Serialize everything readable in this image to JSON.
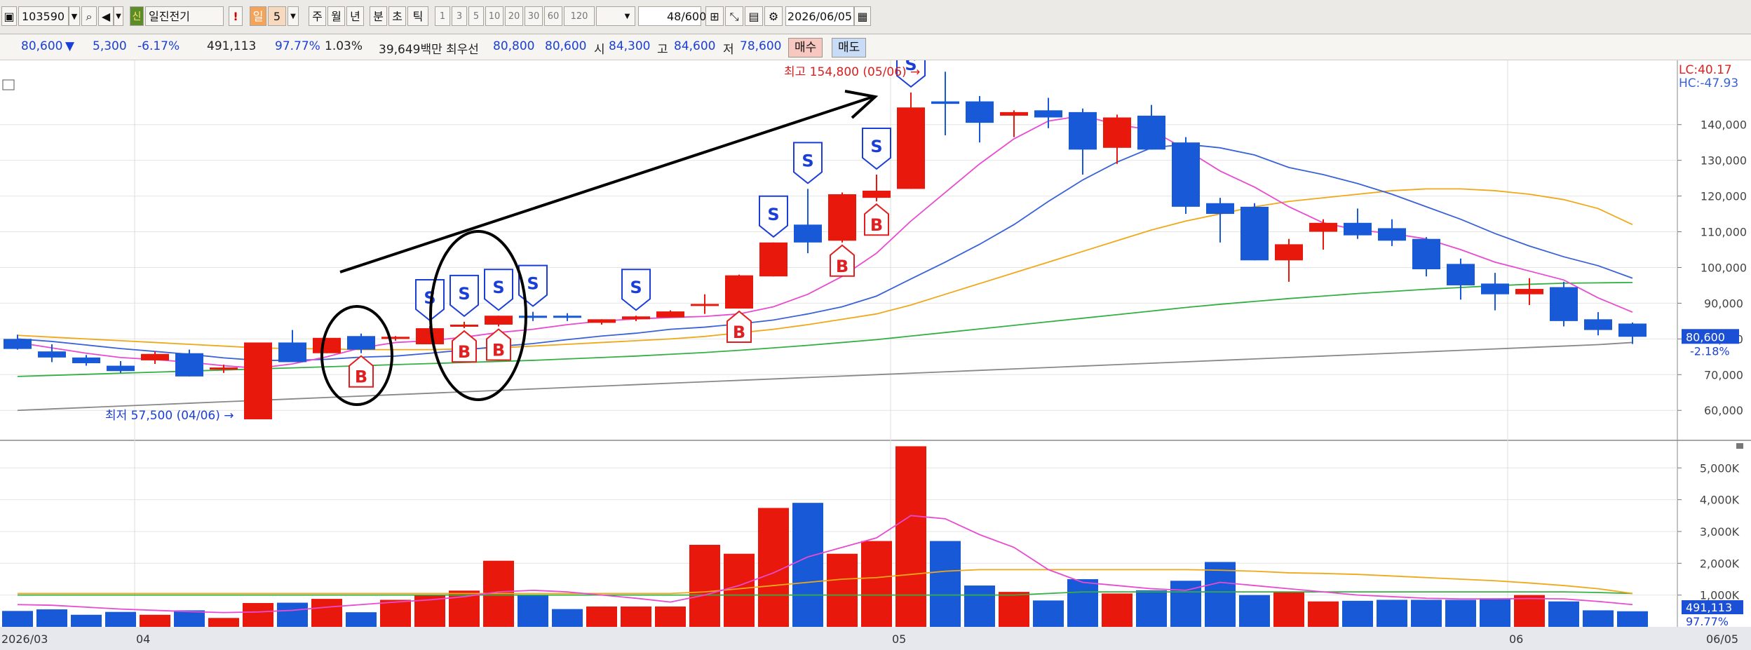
{
  "toolbar": {
    "code": "103590",
    "stock_name": "일진전기",
    "badge": "신",
    "period_active": "일",
    "period_num": "5",
    "period_tabs": [
      "주",
      "월",
      "년",
      "분",
      "초",
      "틱"
    ],
    "minute_options": [
      "1",
      "3",
      "5",
      "10",
      "20",
      "30",
      "60",
      "120"
    ],
    "count_value": "48",
    "count_total": "/600",
    "date": "2026/06/05",
    "icons": [
      "chart-menu-icon",
      "search-icon",
      "sound-icon",
      "alert-icon",
      "add-indicator-icon",
      "line-tool-icon",
      "save-icon",
      "settings-icon",
      "calendar-icon"
    ]
  },
  "quote": {
    "price": "80,600",
    "arrow": "▼",
    "change": "5,300",
    "change_pct": "-6.17%",
    "volume": "491,113",
    "vol_ratio": "97.77%",
    "turnover_pct": "1.03%",
    "amount": "39,649백만",
    "best_label": "최우선",
    "best_ask": "80,800",
    "best_bid": "80,600",
    "open_label": "시",
    "open": "84,300",
    "high_label": "고",
    "high": "84,600",
    "low_label": "저",
    "low": "78,600",
    "buy_label": "매수",
    "sell_label": "매도"
  },
  "annotations": {
    "max_label": "최고 154,800 (05/06)",
    "min_label": "최저 57,500 (04/06)",
    "lc_label": "LC:40.17",
    "hc_label": "HC:-47.93",
    "price_badge": "80,600",
    "price_badge_pct": "-2.18%",
    "vol_badge": "491,113",
    "vol_badge_pct": "97.77%"
  },
  "colors": {
    "up": "#e8180c",
    "down": "#1759d6",
    "ma5": "#e84bd0",
    "ma10": "#3a62d8",
    "ma20": "#f0a818",
    "ma60": "#33b044",
    "ma120": "#888888",
    "signal_b": "#e02020",
    "signal_s": "#1a3fd8"
  },
  "chart_data": [
    {
      "type": "candlestick",
      "yticks": [
        "60,000",
        "70,000",
        "80,000",
        "90,000",
        "100,000",
        "110,000",
        "120,000",
        "130,000",
        "140,000"
      ],
      "ylim": [
        52000,
        158000
      ],
      "xlabels": [
        "2026/03",
        "04",
        "05",
        "06",
        "06/05"
      ],
      "candles": [
        {
          "o": 80000,
          "h": 81200,
          "c": 77200,
          "l": 77000
        },
        {
          "o": 76500,
          "h": 78500,
          "c": 74800,
          "l": 73500
        },
        {
          "o": 74800,
          "h": 75500,
          "c": 73200,
          "l": 72500
        },
        {
          "o": 72500,
          "h": 73800,
          "c": 71000,
          "l": 70500
        },
        {
          "o": 74000,
          "h": 76500,
          "c": 75800,
          "l": 73000
        },
        {
          "o": 76000,
          "h": 77000,
          "c": 69500,
          "l": 69500
        },
        {
          "o": 71500,
          "h": 72800,
          "c": 72000,
          "l": 70500
        },
        {
          "o": 57500,
          "h": 79000,
          "c": 79000,
          "l": 57500
        },
        {
          "o": 79000,
          "h": 82500,
          "c": 73500,
          "l": 73500
        },
        {
          "o": 76000,
          "h": 80300,
          "c": 80300,
          "l": 76000
        },
        {
          "o": 80800,
          "h": 81500,
          "c": 77000,
          "l": 76000
        },
        {
          "o": 80000,
          "h": 80800,
          "c": 80600,
          "l": 79500
        },
        {
          "o": 78500,
          "h": 83600,
          "c": 83000,
          "l": 78500
        },
        {
          "o": 84000,
          "h": 84800,
          "c": 84000,
          "l": 83000
        },
        {
          "o": 84000,
          "h": 86500,
          "c": 86500,
          "l": 83500
        },
        {
          "o": 86500,
          "h": 87600,
          "c": 85900,
          "l": 85000
        },
        {
          "o": 86500,
          "h": 87200,
          "c": 86000,
          "l": 85000
        },
        {
          "o": 84500,
          "h": 85500,
          "c": 85500,
          "l": 84000
        },
        {
          "o": 85500,
          "h": 86500,
          "c": 86300,
          "l": 85000
        },
        {
          "o": 86000,
          "h": 88000,
          "c": 87700,
          "l": 86000
        },
        {
          "o": 89500,
          "h": 92500,
          "c": 89800,
          "l": 87000
        },
        {
          "o": 88500,
          "h": 98000,
          "c": 97800,
          "l": 88500
        },
        {
          "o": 97500,
          "h": 107000,
          "c": 107000,
          "l": 97500
        },
        {
          "o": 112000,
          "h": 122000,
          "c": 107000,
          "l": 104000
        },
        {
          "o": 107500,
          "h": 121000,
          "c": 120500,
          "l": 107000
        },
        {
          "o": 119500,
          "h": 126000,
          "c": 121500,
          "l": 118500
        },
        {
          "o": 122000,
          "h": 149000,
          "c": 144800,
          "l": 122000
        },
        {
          "o": 146500,
          "h": 154800,
          "c": 145800,
          "l": 137000
        },
        {
          "o": 146500,
          "h": 148000,
          "c": 140500,
          "l": 135000
        },
        {
          "o": 142500,
          "h": 144000,
          "c": 143500,
          "l": 136500
        },
        {
          "o": 144000,
          "h": 147500,
          "c": 142000,
          "l": 139000
        },
        {
          "o": 143500,
          "h": 144500,
          "c": 133000,
          "l": 126000
        },
        {
          "o": 133500,
          "h": 142800,
          "c": 142000,
          "l": 129000
        },
        {
          "o": 142500,
          "h": 145500,
          "c": 133000,
          "l": 133000
        },
        {
          "o": 135000,
          "h": 136500,
          "c": 117000,
          "l": 115000
        },
        {
          "o": 118000,
          "h": 119500,
          "c": 115000,
          "l": 107000
        },
        {
          "o": 117000,
          "h": 118000,
          "c": 102000,
          "l": 102000
        },
        {
          "o": 102000,
          "h": 108000,
          "c": 106500,
          "l": 96000
        },
        {
          "o": 110000,
          "h": 113500,
          "c": 112500,
          "l": 105000
        },
        {
          "o": 112500,
          "h": 116500,
          "c": 109000,
          "l": 108000
        },
        {
          "o": 111000,
          "h": 113500,
          "c": 107500,
          "l": 106000
        },
        {
          "o": 108000,
          "h": 108500,
          "c": 99500,
          "l": 97500
        },
        {
          "o": 101000,
          "h": 102500,
          "c": 95000,
          "l": 91000
        },
        {
          "o": 95500,
          "h": 98500,
          "c": 92500,
          "l": 88000
        },
        {
          "o": 92500,
          "h": 97000,
          "c": 94000,
          "l": 89500
        },
        {
          "o": 94500,
          "h": 96000,
          "c": 85000,
          "l": 83500
        },
        {
          "o": 85500,
          "h": 87500,
          "c": 82500,
          "l": 81000
        },
        {
          "o": 84300,
          "h": 84600,
          "c": 80600,
          "l": 78600
        }
      ],
      "moving_averages": {
        "ma5": [
          79000,
          77500,
          76000,
          74800,
          74200,
          73500,
          72500,
          71800,
          73000,
          75000,
          77500,
          79000,
          79500,
          80500,
          81800,
          82700,
          84000,
          85000,
          85600,
          86000,
          86300,
          87000,
          89000,
          92500,
          97500,
          104000,
          113000,
          121000,
          129000,
          136000,
          141000,
          142500,
          140000,
          138500,
          133000,
          127000,
          122500,
          117000,
          112500,
          110500,
          109500,
          108000,
          105000,
          101500,
          99000,
          96500,
          91500,
          87500
        ],
        "ma10": [
          80000,
          79300,
          78300,
          77300,
          76500,
          75700,
          74700,
          74000,
          74000,
          74300,
          74900,
          75200,
          76000,
          76900,
          77900,
          78700,
          79800,
          80800,
          81600,
          82700,
          83300,
          84200,
          85300,
          87000,
          89000,
          92000,
          96800,
          101500,
          106500,
          112000,
          118500,
          124500,
          129500,
          133500,
          134500,
          133500,
          131500,
          128000,
          126000,
          123500,
          120500,
          117000,
          113500,
          109500,
          106000,
          103000,
          100500,
          97000
        ],
        "ma20": [
          81000,
          80500,
          80000,
          79500,
          79000,
          78500,
          78000,
          77500,
          77300,
          77200,
          77000,
          77000,
          77000,
          77200,
          77500,
          78000,
          78500,
          79000,
          79500,
          80000,
          80700,
          81700,
          82700,
          84000,
          85500,
          87000,
          89500,
          92500,
          95500,
          98500,
          101500,
          104500,
          107500,
          110500,
          113000,
          115000,
          117000,
          118500,
          119500,
          120500,
          121500,
          122000,
          122000,
          121500,
          120500,
          119000,
          116500,
          112000
        ],
        "ma60": [
          69500,
          69800,
          70100,
          70400,
          70700,
          71000,
          71300,
          71600,
          71900,
          72200,
          72500,
          72800,
          73100,
          73400,
          73700,
          74000,
          74400,
          74800,
          75200,
          75700,
          76200,
          76800,
          77500,
          78200,
          79000,
          79800,
          80800,
          81800,
          82800,
          83800,
          84800,
          85800,
          86800,
          87800,
          88800,
          89700,
          90500,
          91300,
          92000,
          92700,
          93300,
          93900,
          94400,
          94900,
          95300,
          95600,
          95700,
          95800
        ],
        "ma120": [
          60000,
          60400,
          60800,
          61200,
          61600,
          62000,
          62400,
          62800,
          63200,
          63600,
          64000,
          64400,
          64800,
          65200,
          65600,
          66000,
          66400,
          66800,
          67200,
          67600,
          68000,
          68400,
          68800,
          69200,
          69600,
          70000,
          70400,
          70800,
          71200,
          71600,
          72000,
          72400,
          72800,
          73200,
          73600,
          74000,
          74400,
          74800,
          75200,
          75600,
          76000,
          76400,
          76800,
          77200,
          77600,
          78000,
          78400,
          79000
        ]
      },
      "signals": [
        {
          "i": 10,
          "type": "B"
        },
        {
          "i": 12,
          "type": "S"
        },
        {
          "i": 13,
          "type": "S"
        },
        {
          "i": 13,
          "type": "B"
        },
        {
          "i": 14,
          "type": "S"
        },
        {
          "i": 14,
          "type": "B"
        },
        {
          "i": 15,
          "type": "S"
        },
        {
          "i": 18,
          "type": "S"
        },
        {
          "i": 21,
          "type": "B"
        },
        {
          "i": 22,
          "type": "S"
        },
        {
          "i": 23,
          "type": "S"
        },
        {
          "i": 24,
          "type": "B"
        },
        {
          "i": 25,
          "type": "B"
        },
        {
          "i": 25,
          "type": "S"
        },
        {
          "i": 26,
          "type": "S"
        }
      ]
    },
    {
      "type": "bar",
      "yticks": [
        "1,000K",
        "2,000K",
        "3,000K",
        "4,000K",
        "5,000K"
      ],
      "ylim": [
        0,
        5800
      ],
      "volume_k": [
        500,
        550,
        380,
        470,
        380,
        520,
        280,
        750,
        760,
        880,
        460,
        850,
        1000,
        1140,
        2080,
        1000,
        560,
        640,
        640,
        640,
        2580,
        2300,
        3740,
        3900,
        2300,
        2700,
        5680,
        2700,
        1300,
        1100,
        830,
        1500,
        1050,
        1150,
        1450,
        2040,
        1000,
        1100,
        800,
        820,
        850,
        850,
        850,
        900,
        1000,
        800,
        520,
        491
      ],
      "vol_ma5": [
        700,
        680,
        620,
        560,
        520,
        480,
        450,
        470,
        520,
        620,
        700,
        780,
        850,
        950,
        1100,
        1150,
        1100,
        1000,
        900,
        780,
        1000,
        1300,
        1700,
        2200,
        2500,
        2800,
        3500,
        3400,
        2900,
        2500,
        1800,
        1400,
        1300,
        1200,
        1150,
        1400,
        1300,
        1200,
        1100,
        1000,
        950,
        900,
        880,
        880,
        890,
        880,
        800,
        700
      ],
      "vol_ma20": [
        1050,
        1050,
        1050,
        1050,
        1050,
        1050,
        1050,
        1050,
        1050,
        1050,
        1050,
        1050,
        1050,
        1050,
        1050,
        1050,
        1050,
        1050,
        1050,
        1050,
        1100,
        1200,
        1300,
        1400,
        1500,
        1550,
        1650,
        1750,
        1800,
        1800,
        1800,
        1800,
        1800,
        1800,
        1800,
        1780,
        1750,
        1700,
        1680,
        1650,
        1600,
        1550,
        1500,
        1450,
        1380,
        1300,
        1200,
        1050
      ],
      "vol_ma60": [
        1000,
        1000,
        1000,
        1000,
        1000,
        1000,
        1000,
        1000,
        1000,
        1000,
        1000,
        1000,
        1000,
        1000,
        1000,
        1000,
        1000,
        1000,
        1000,
        1000,
        1000,
        1000,
        1000,
        1000,
        1000,
        1000,
        1000,
        1000,
        1000,
        1000,
        1050,
        1100,
        1100,
        1100,
        1100,
        1100,
        1100,
        1100,
        1100,
        1100,
        1100,
        1100,
        1100,
        1100,
        1100,
        1100,
        1080,
        1050
      ]
    }
  ]
}
